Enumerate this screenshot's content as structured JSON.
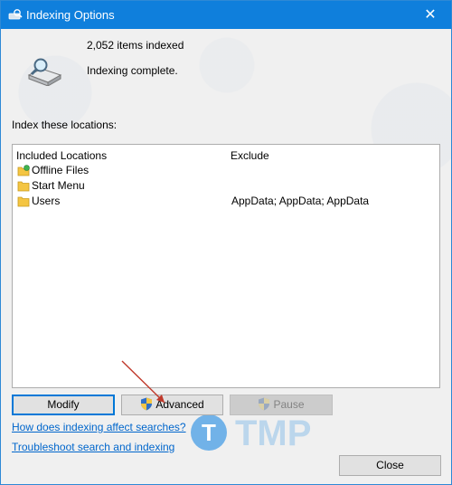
{
  "window": {
    "title": "Indexing Options",
    "close_glyph": "✕"
  },
  "status": {
    "items_indexed": "2,052 items indexed",
    "state": "Indexing complete."
  },
  "locations": {
    "label": "Index these locations:",
    "columns": [
      "Included Locations",
      "Exclude"
    ],
    "rows": [
      {
        "name": "Offline Files",
        "exclude": "",
        "icon": "offline-files-icon"
      },
      {
        "name": "Start Menu",
        "exclude": "",
        "icon": "folder-icon"
      },
      {
        "name": "Users",
        "exclude": "AppData; AppData; AppData",
        "icon": "folder-icon"
      }
    ]
  },
  "buttons": {
    "modify": "Modify",
    "advanced": "Advanced",
    "pause": "Pause",
    "close": "Close"
  },
  "links": {
    "help": "How does indexing affect searches?",
    "troubleshoot": "Troubleshoot search and indexing"
  },
  "watermark": {
    "letter": "T",
    "text": "TMP"
  },
  "colors": {
    "titlebar": "#0f7fdc",
    "link": "#0066cc",
    "default_button_border": "#0078d7",
    "annotation_arrow": "#c0392b",
    "watermark": "#5aa7e6"
  }
}
